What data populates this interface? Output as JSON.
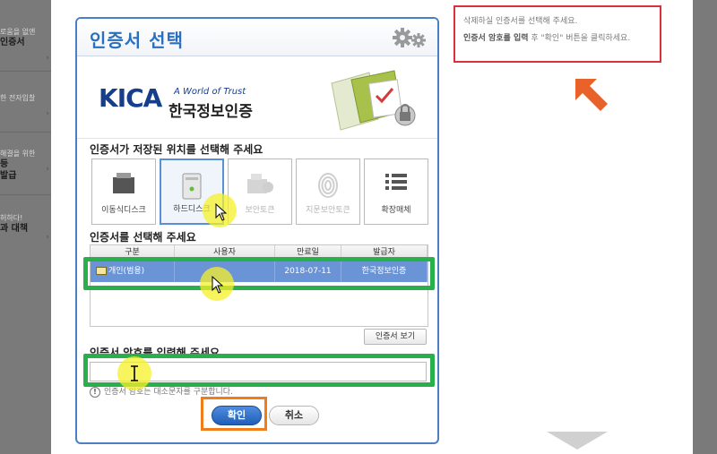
{
  "left_menu": {
    "items": [
      {
        "line1": "로움을 없앤",
        "line2": "인증서"
      },
      {
        "line1": "한 전자입찰",
        "line2": ""
      },
      {
        "line1": "해결을 위한",
        "line2": "등",
        "line3": "발급"
      },
      {
        "line1": "허하다!",
        "line2": "과 대책"
      }
    ]
  },
  "dialog": {
    "title": "인증서 선택",
    "logo": {
      "brand": "KICA",
      "tagline": "A World of Trust",
      "name": "한국정보인증"
    },
    "location_label": "인증서가 저장된 위치를 선택해 주세요",
    "devices": [
      {
        "label": "이동식디스크",
        "icon": "usb-drive-icon",
        "state": "enabled"
      },
      {
        "label": "하드디스크",
        "icon": "hard-disk-icon",
        "state": "selected"
      },
      {
        "label": "보안토큰",
        "icon": "security-token-icon",
        "state": "disabled"
      },
      {
        "label": "지문보안토큰",
        "icon": "fingerprint-icon",
        "state": "disabled"
      },
      {
        "label": "확장매체",
        "icon": "list-icon",
        "state": "enabled"
      }
    ],
    "cert_label": "인증서를 선택해 주세요",
    "table": {
      "columns": [
        "구분",
        "사용자",
        "만료일",
        "발급자"
      ],
      "rows": [
        {
          "type": "개인(범용)",
          "user": "",
          "expiry": "2018-07-11",
          "issuer": "한국정보인증"
        }
      ]
    },
    "view_cert_label": "인증서 보기",
    "password_label": "인증서 암호를 입력해 주세요",
    "password_value": "",
    "password_note": "인증서 암호는 대소문자를 구분합니다.",
    "ok_label": "확인",
    "cancel_label": "취소"
  },
  "instructions": {
    "line1": "삭제하실 인증서를 선택해 주세요.",
    "line2_bold": "인증서 암호를 입력",
    "line2_rest": " 후 \"확인\" 버튼을 클릭하세요."
  },
  "colors": {
    "accent": "#2b6fbf",
    "selected_row": "#6b94d6",
    "highlight_green": "#2ab04a",
    "highlight_orange": "#ef7d1a",
    "instruction_border": "#d9303a",
    "arrow": "#e8622a"
  }
}
